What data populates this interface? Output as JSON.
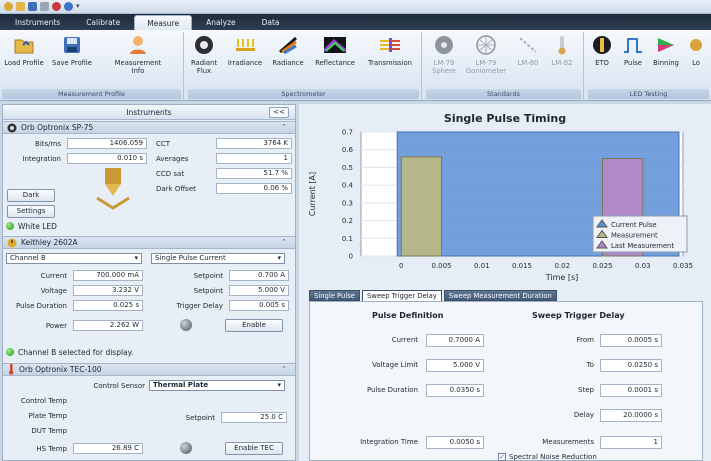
{
  "ribbon": {
    "tabs": [
      "Instruments",
      "Calibrate",
      "Measure",
      "Analyze",
      "Data"
    ],
    "active_tab": "Measure",
    "groups": {
      "measurement_profile": {
        "label": "Measurement Profile",
        "buttons": [
          "Load Profile",
          "Save Profile",
          "Measurement Info"
        ]
      },
      "spectrometer": {
        "label": "Spectrometer",
        "buttons": [
          "Radiant Flux",
          "Irradiance",
          "Radiance",
          "Reflectance",
          "Transmission"
        ]
      },
      "standards": {
        "label": "Standards",
        "buttons": [
          "LM-79 Sphere",
          "LM-79 Goniometer",
          "LM-80",
          "LM-82"
        ]
      },
      "led_testing": {
        "label": "LED Testing",
        "buttons": [
          "ETO",
          "Pulse",
          "Binning",
          "Lo"
        ]
      }
    }
  },
  "instruments_panel": {
    "title": "Instruments",
    "collapse_label": "<<",
    "spectrometer": {
      "name": "Orb Optronix SP-75",
      "bits_label": "Bits/ms",
      "bits_value": "1406.059",
      "integration_label": "Integration",
      "integration_value": "0.010 s",
      "cct_label": "CCT",
      "cct_value": "3764 K",
      "averages_label": "Averages",
      "averages_value": "1",
      "ccd_label": "CCD sat",
      "ccd_value": "51.7 %",
      "dark_offset_label": "Dark Offset",
      "dark_offset_value": "0.06 %",
      "dark_button": "Dark",
      "settings_button": "Settings"
    },
    "white_led_status": "White LED",
    "keithley": {
      "name": "Keithley 2602A",
      "channel_select": "Channel B",
      "mode_select": "Single Pulse Current",
      "current_label": "Current",
      "current_value": "700.000 mA",
      "setpoint1_label": "Setpoint",
      "setpoint1_value": "0.700 A",
      "voltage_label": "Voltage",
      "voltage_value": "3.232 V",
      "setpoint2_label": "Setpoint",
      "setpoint2_value": "5.000 V",
      "pulse_duration_label": "Pulse Duration",
      "pulse_duration_value": "0.025 s",
      "trigger_delay_label": "Trigger Delay",
      "trigger_delay_value": "0.005 s",
      "power_label": "Power",
      "power_value": "2.262 W",
      "enable_button": "Enable"
    },
    "channel_status": "Channel B selected for display.",
    "tec": {
      "name": "Orb Optronix TEC-100",
      "control_sensor_label": "Control Sensor",
      "control_sensor_value": "Thermal Plate",
      "control_temp_label": "Control Temp",
      "plate_temp_label": "Plate Temp",
      "setpoint_label": "Setpoint",
      "setpoint_value": "25.0 C",
      "dut_temp_label": "DUT Temp",
      "hs_temp_label": "HS Temp",
      "hs_temp_value": "26.89 C",
      "enable_button": "Enable TEC"
    }
  },
  "chart_data": {
    "type": "bar",
    "title": "Single Pulse Timing",
    "xlabel": "Time [s]",
    "ylabel": "Current [A]",
    "xlim": [
      -0.005,
      0.035
    ],
    "ylim": [
      0,
      0.7
    ],
    "x_ticks": [
      "0",
      "0.005",
      "0.01",
      "0.015",
      "0.02",
      "0.025",
      "0.03",
      "0.035"
    ],
    "y_ticks": [
      "0",
      "0.1",
      "0.2",
      "0.3",
      "0.4",
      "0.5",
      "0.6",
      "0.7"
    ],
    "series": [
      {
        "name": "Current Pulse",
        "color": "#5b8fd6",
        "x_start": -0.0005,
        "x_end": 0.0345,
        "value": 0.7
      },
      {
        "name": "Measurement",
        "color": "#b8b886",
        "x_start": 0.0,
        "x_end": 0.005,
        "value": 0.56
      },
      {
        "name": "Last Measurement",
        "color": "#b388c8",
        "x_start": 0.025,
        "x_end": 0.03,
        "value": 0.55
      }
    ],
    "legend": "bottom-right",
    "grid": true
  },
  "settings": {
    "tabs": [
      "Single Pulse",
      "Sweep Trigger Delay",
      "Sweep Measurement Duration"
    ],
    "active_tab": "Sweep Trigger Delay",
    "pulse_definition_heading": "Pulse Definition",
    "sweep_heading": "Sweep Trigger Delay",
    "current_label": "Current",
    "current_value": "0.7000 A",
    "voltage_limit_label": "Voltage Limit",
    "voltage_limit_value": "5.000 V",
    "pulse_duration_label": "Pulse Duration",
    "pulse_duration_value": "0.0350 s",
    "integration_time_label": "Integration Time",
    "integration_time_value": "0.0050 s",
    "from_label": "From",
    "from_value": "0.0005 s",
    "to_label": "To",
    "to_value": "0.0250 s",
    "step_label": "Step",
    "step_value": "0.0001 s",
    "delay_label": "Delay",
    "delay_value": "20.0000 s",
    "measurements_label": "Measurements",
    "measurements_value": "1",
    "spectral_noise_label": "Spectral Noise Reduction"
  }
}
